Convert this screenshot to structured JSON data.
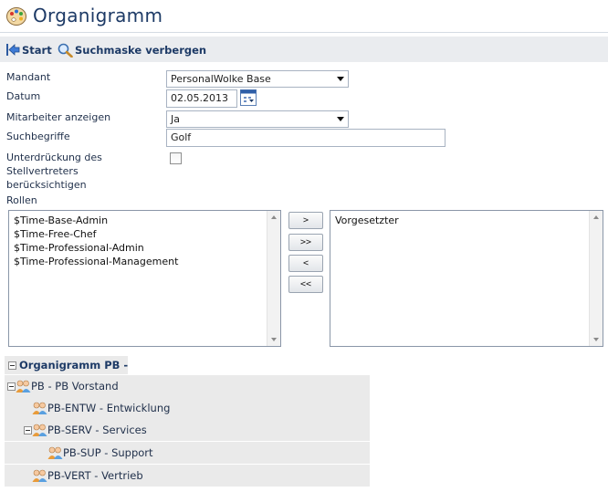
{
  "page": {
    "title": "Organigramm"
  },
  "toolbar": {
    "start_label": "Start",
    "hide_search_label": "Suchmaske verbergen"
  },
  "form": {
    "mandant": {
      "label": "Mandant",
      "value": "PersonalWolke Base"
    },
    "datum": {
      "label": "Datum",
      "value": "02.05.2013"
    },
    "mitarbeiter": {
      "label": "Mitarbeiter anzeigen",
      "value": "Ja"
    },
    "suchbegriffe": {
      "label": "Suchbegriffe",
      "value": "Golf"
    },
    "unterdrueckung": {
      "label_line1": "Unterdrückung des",
      "label_line2": "Stellvertreters",
      "label_line3": "berücksichtigen",
      "checked": false
    },
    "rollen": {
      "label": "Rollen",
      "available": [
        "$Time-Base-Admin",
        "$Time-Free-Chef",
        "$Time-Professional-Admin",
        "$Time-Professional-Management"
      ],
      "selected": [
        "Vorgesetzter"
      ],
      "buttons": {
        "add": ">",
        "add_all": ">>",
        "remove": "<",
        "remove_all": "<<"
      }
    }
  },
  "tree": {
    "root": "Organigramm PB -",
    "nodes": [
      {
        "label": "PB - PB Vorstand"
      },
      {
        "label": "PB-ENTW - Entwicklung"
      },
      {
        "label": "PB-SERV - Services"
      },
      {
        "label": "PB-SUP - Support"
      },
      {
        "label": "PB-VERT - Vertrieb"
      }
    ]
  },
  "colors": {
    "title": "#1d3a66",
    "toolbar_bg": "#eaecef",
    "tree_row_bg": "#eaeaea"
  }
}
